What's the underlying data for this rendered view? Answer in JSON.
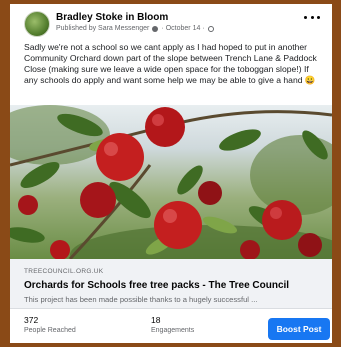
{
  "post": {
    "page_name": "Bradley Stoke in Bloom",
    "meta_published": "Published by Sara Messenger",
    "meta_date": "October 14",
    "text": "Sadly we're not a school so we cant apply as I had hoped to put in another Community Orchard down part of the slope between Trench Lane & Paddock Close (making sure we leave a wide open space for the toboggan slope!) If any schools do apply and want some help we may be able to give a hand 😀"
  },
  "link": {
    "source": "TREECOUNCIL.ORG.UK",
    "title": "Orchards for Schools free tree packs - The Tree Council",
    "description": "This project has been made possible thanks to a hugely successful ..."
  },
  "stats": {
    "reached_value": "372",
    "reached_label": "People Reached",
    "engagements_value": "18",
    "engagements_label": "Engagements"
  },
  "actions": {
    "boost_label": "Boost Post"
  },
  "colors": {
    "frame": "#8a4a17",
    "accent": "#1877f2",
    "apple": "#c41f1f"
  }
}
